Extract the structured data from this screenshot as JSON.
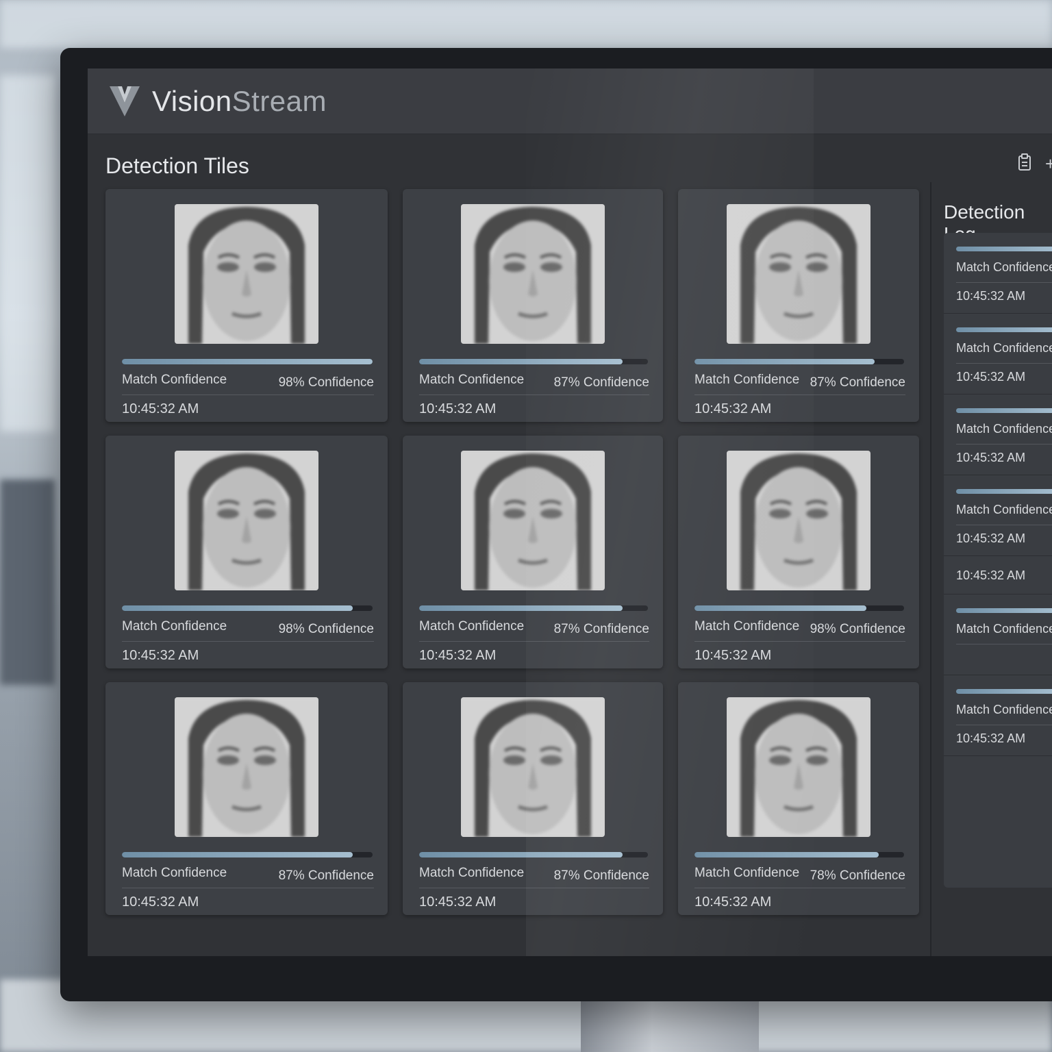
{
  "app": {
    "brand_primary": "Vision",
    "brand_secondary": "Stream"
  },
  "main": {
    "section_title": "Detection Tiles"
  },
  "toolbar": {
    "icons": [
      "clipboard-icon",
      "plus-icon"
    ],
    "plus_glyph": "+"
  },
  "tiles": [
    {
      "label": "Match Confidence",
      "confidence": "98% Confidence",
      "time": "10:45:32 AM",
      "fill": 1.0
    },
    {
      "label": "Match Confidence",
      "confidence": "87% Confidence",
      "time": "10:45:32 AM",
      "fill": 0.89
    },
    {
      "label": "Match Confidence",
      "confidence": "87% Confidence",
      "time": "10:45:32 AM",
      "fill": 0.86
    },
    {
      "label": "Match Confidence",
      "confidence": "98% Confidence",
      "time": "10:45:32 AM",
      "fill": 0.92
    },
    {
      "label": "Match Confidence",
      "confidence": "87% Confidence",
      "time": "10:45:32 AM",
      "fill": 0.89
    },
    {
      "label": "Match Confidence",
      "confidence": "98% Confidence",
      "time": "10:45:32 AM",
      "fill": 0.82
    },
    {
      "label": "Match Confidence",
      "confidence": "87% Confidence",
      "time": "10:45:32 AM",
      "fill": 0.92
    },
    {
      "label": "Match Confidence",
      "confidence": "87% Confidence",
      "time": "10:45:32 AM",
      "fill": 0.89
    },
    {
      "label": "Match Confidence",
      "confidence": "78% Confidence",
      "time": "10:45:32 AM",
      "fill": 0.88
    }
  ],
  "log": {
    "title": "Detection Log",
    "items": [
      {
        "label": "Match Confidence",
        "time": "10:45:32 AM"
      },
      {
        "label": "Match Confidence",
        "time": "10:45:32 AM"
      },
      {
        "label": "Match Confidence",
        "time": "10:45:32 AM"
      },
      {
        "label": "Match Confidence",
        "time": "10:45:32 AM"
      },
      {
        "label": "",
        "time": "10:45:32 AM"
      },
      {
        "label": "Match Confidence",
        "time": ""
      },
      {
        "label": "Match Confidence",
        "time": "10:45:32 AM"
      }
    ]
  },
  "colors": {
    "accent": "#8fb0c6",
    "tile_bg": "#3d4045",
    "screen_bg": "#303236"
  }
}
